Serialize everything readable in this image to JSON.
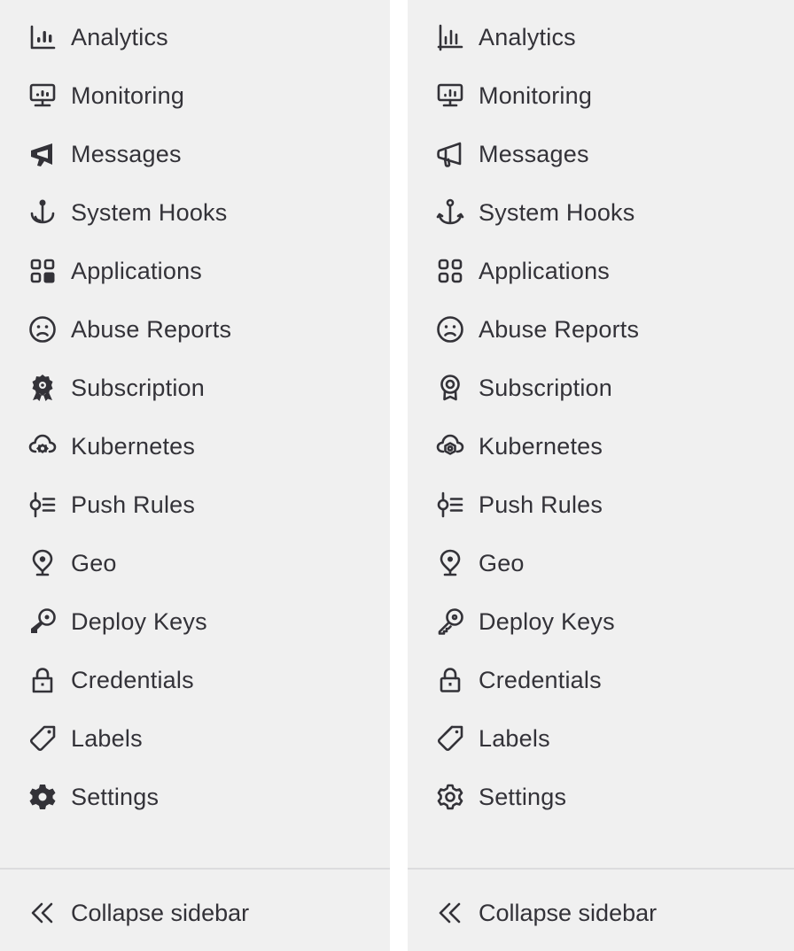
{
  "panels": [
    {
      "variant": "filled",
      "items": [
        {
          "label": "Analytics",
          "icon": "chart-icon"
        },
        {
          "label": "Monitoring",
          "icon": "monitor-icon"
        },
        {
          "label": "Messages",
          "icon": "megaphone-icon"
        },
        {
          "label": "System Hooks",
          "icon": "hook-icon"
        },
        {
          "label": "Applications",
          "icon": "applications-icon"
        },
        {
          "label": "Abuse Reports",
          "icon": "slight-frown-icon"
        },
        {
          "label": "Subscription",
          "icon": "license-icon"
        },
        {
          "label": "Kubernetes",
          "icon": "cloud-gear-icon"
        },
        {
          "label": "Push Rules",
          "icon": "push-rules-icon"
        },
        {
          "label": "Geo",
          "icon": "location-icon"
        },
        {
          "label": "Deploy Keys",
          "icon": "key-icon"
        },
        {
          "label": "Credentials",
          "icon": "lock-icon"
        },
        {
          "label": "Labels",
          "icon": "label-icon"
        },
        {
          "label": "Settings",
          "icon": "settings-icon"
        }
      ],
      "collapse_label": "Collapse sidebar"
    },
    {
      "variant": "outline",
      "items": [
        {
          "label": "Analytics",
          "icon": "chart-icon"
        },
        {
          "label": "Monitoring",
          "icon": "monitor-icon"
        },
        {
          "label": "Messages",
          "icon": "megaphone-icon"
        },
        {
          "label": "System Hooks",
          "icon": "hook-icon"
        },
        {
          "label": "Applications",
          "icon": "applications-icon"
        },
        {
          "label": "Abuse Reports",
          "icon": "slight-frown-icon"
        },
        {
          "label": "Subscription",
          "icon": "license-icon"
        },
        {
          "label": "Kubernetes",
          "icon": "cloud-gear-icon"
        },
        {
          "label": "Push Rules",
          "icon": "push-rules-icon"
        },
        {
          "label": "Geo",
          "icon": "location-icon"
        },
        {
          "label": "Deploy Keys",
          "icon": "key-icon"
        },
        {
          "label": "Credentials",
          "icon": "lock-icon"
        },
        {
          "label": "Labels",
          "icon": "label-icon"
        },
        {
          "label": "Settings",
          "icon": "settings-icon"
        }
      ],
      "collapse_label": "Collapse sidebar"
    }
  ],
  "colors": {
    "background": "#f0f0f0",
    "text": "#333238",
    "divider": "#dcdcde",
    "gutter": "#ffffff"
  }
}
